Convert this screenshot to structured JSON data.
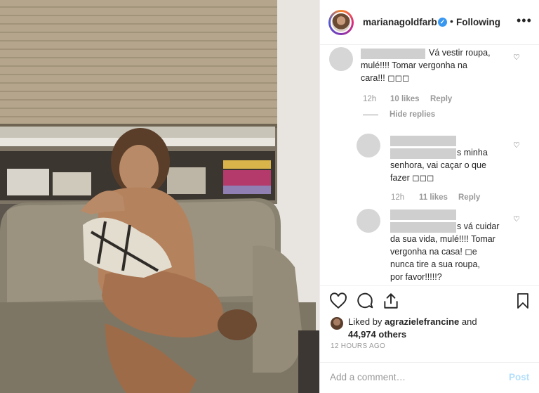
{
  "post": {
    "username": "marianagoldfarb",
    "separator": "•",
    "follow_status": "Following",
    "more_label": "•••"
  },
  "comments": [
    {
      "text_lines": [
        "Vá vestir roupa,",
        "mulé!!!! Tomar vergonha na",
        "cara!!! ◻◻◻"
      ],
      "age": "12h",
      "likes": "10 likes",
      "reply": "Reply",
      "hide_replies": "Hide replies"
    },
    {
      "text_lines": [
        "s minha",
        "senhora, vai caçar o que",
        "fazer ◻◻◻"
      ],
      "age": "12h",
      "likes": "11 likes",
      "reply": "Reply"
    },
    {
      "text_lines": [
        "s vá cuidar",
        "da sua vida, mulé!!!! Tomar",
        "vergonha na casa! ◻e",
        "nunca tire a sua roupa,",
        "por favor!!!!!?"
      ]
    }
  ],
  "likes": {
    "prefix": "Liked by ",
    "user": "agrazielefrancine",
    "connector": " and",
    "count": "44,974 others"
  },
  "timestamp": "12 HOURS AGO",
  "add_comment": {
    "placeholder": "Add a comment…",
    "post_label": "Post"
  },
  "icons": [
    "heart-icon",
    "comment-icon",
    "share-icon",
    "bookmark-icon",
    "verified-icon",
    "more-icon"
  ],
  "colors": {
    "link_blue": "#3897f0",
    "post_disabled": "#b2dffc",
    "meta_gray": "#999999"
  }
}
